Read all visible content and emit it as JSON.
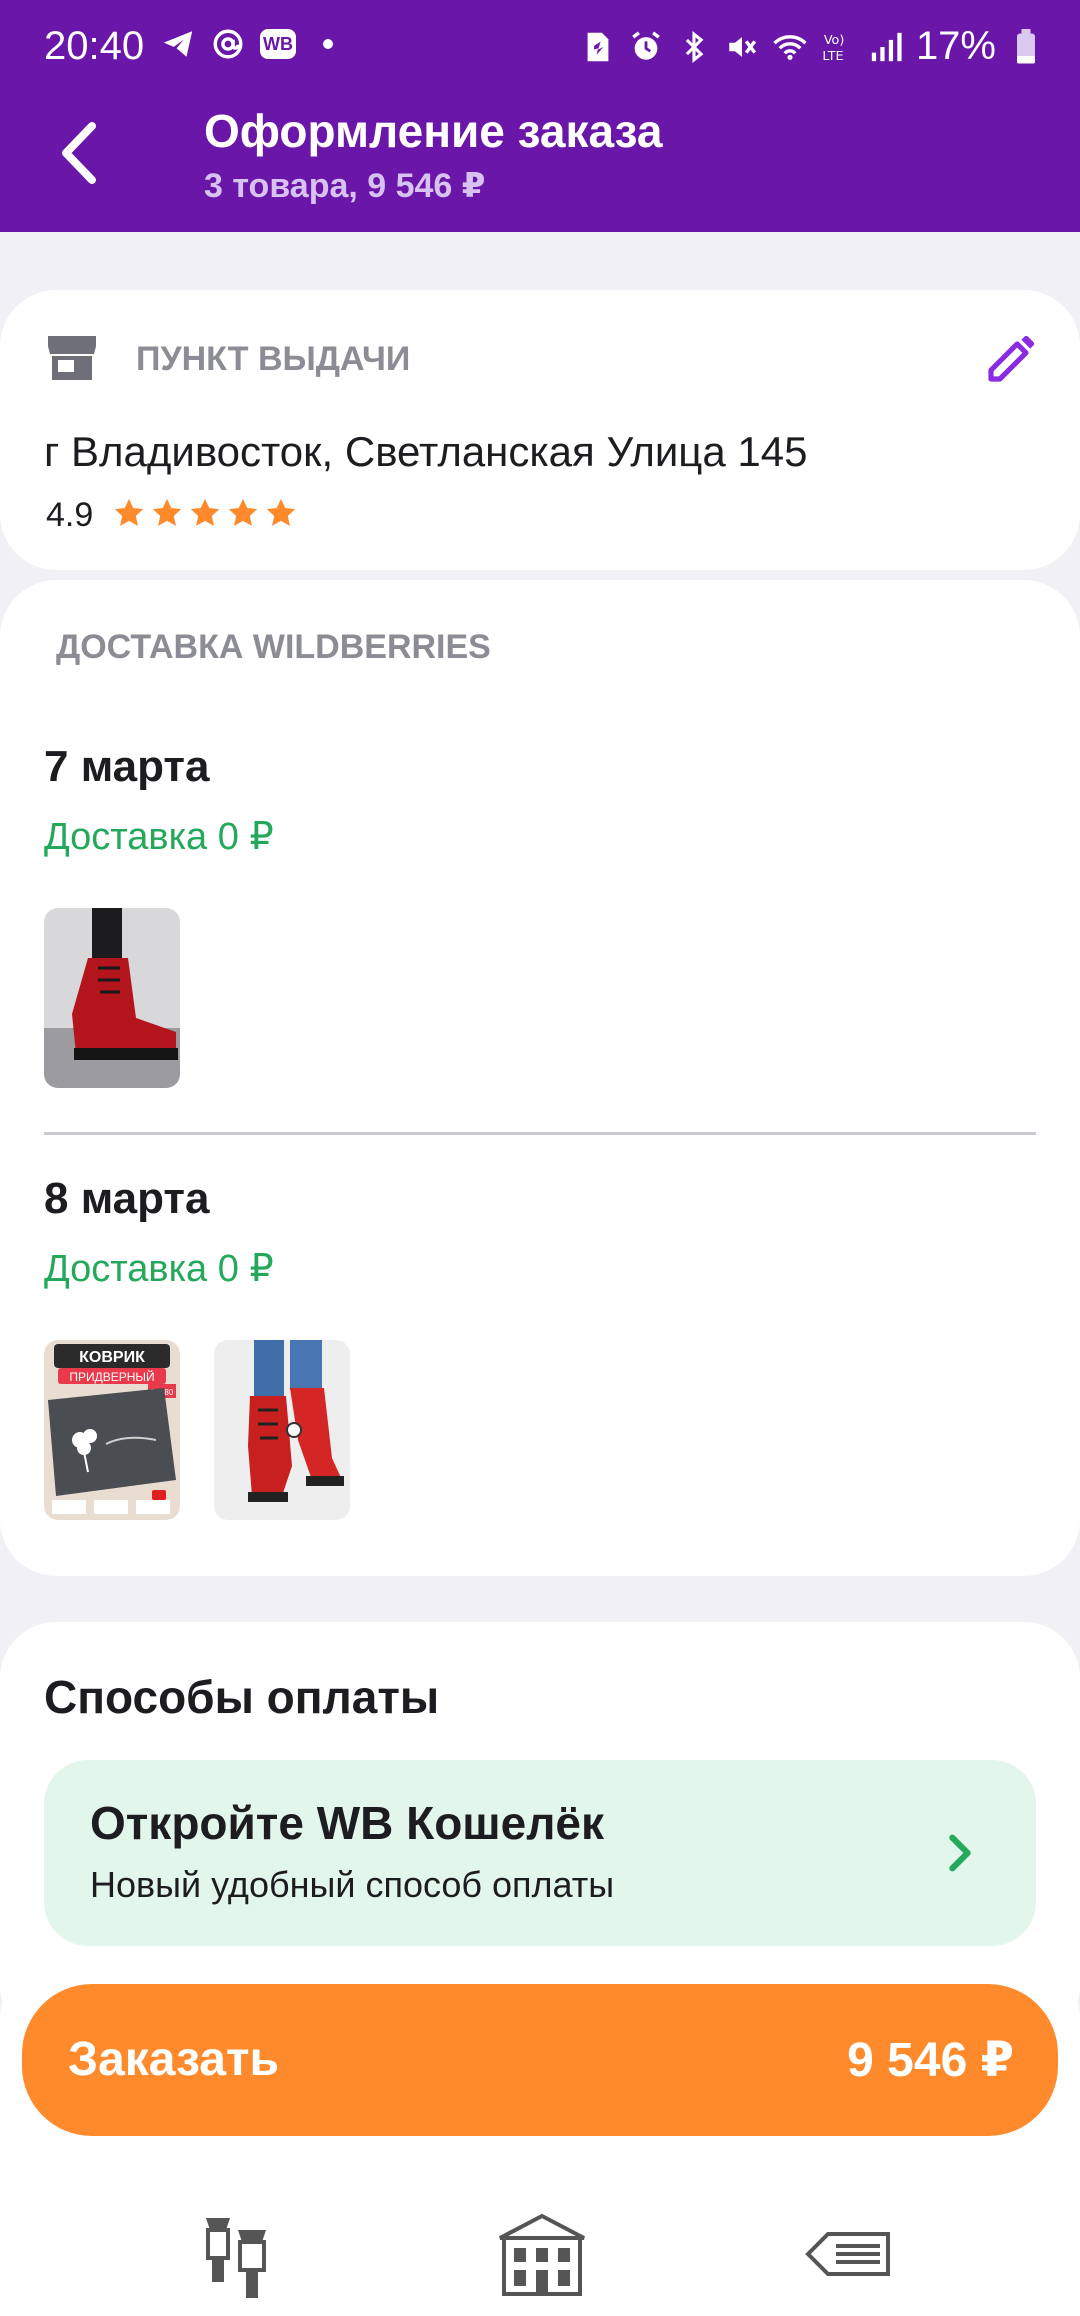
{
  "status_bar": {
    "time": "20:40",
    "battery": "17%",
    "left_icons": [
      "telegram-icon",
      "at-sign-icon",
      "wb-app-icon",
      "dot-icon"
    ],
    "right_icons": [
      "sim-icon",
      "alarm-icon",
      "bluetooth-icon",
      "mute-icon",
      "wifi-icon",
      "volte-icon",
      "signal-icon",
      "battery-icon"
    ],
    "wb_chip": "WB"
  },
  "header": {
    "title": "Оформление заказа",
    "subtitle": "3 товара, 9 546 ₽",
    "back_icon": "chevron-left-icon",
    "bg_color": "#6a16a8"
  },
  "pickup": {
    "label": "ПУНКТ ВЫДАЧИ",
    "address": "г Владивосток, Светланская Улица 145",
    "rating": "4.9",
    "stars": 5,
    "icons": [
      "store-icon",
      "edit-icon"
    ]
  },
  "delivery": {
    "label": "ДОСТАВКА WILDBERRIES",
    "groups": [
      {
        "date": "7 марта",
        "fee": "Доставка 0 ₽",
        "items": [
          "product-red-boots-photo"
        ]
      },
      {
        "date": "8 марта",
        "fee": "Доставка 0 ₽",
        "items": [
          "product-door-mat-photo",
          "product-red-boots-jeans-photo"
        ]
      }
    ],
    "mat_label_1": "КОВРИК",
    "mat_label_2": "ПРИДВЕРНЫЙ",
    "mat_size": "50×80"
  },
  "payment": {
    "title": "Способы оплаты",
    "wallet_title": "Откройте WB Кошелёк",
    "wallet_subtitle": "Новый удобный способ оплаты",
    "chevron_color": "#24a85c"
  },
  "order": {
    "button_label": "Заказать",
    "total": "9 546 ₽",
    "button_color": "#ff8a2b"
  },
  "bottom_nav": [
    "lanterns-icon",
    "building-icon",
    "sign-arrow-icon"
  ]
}
